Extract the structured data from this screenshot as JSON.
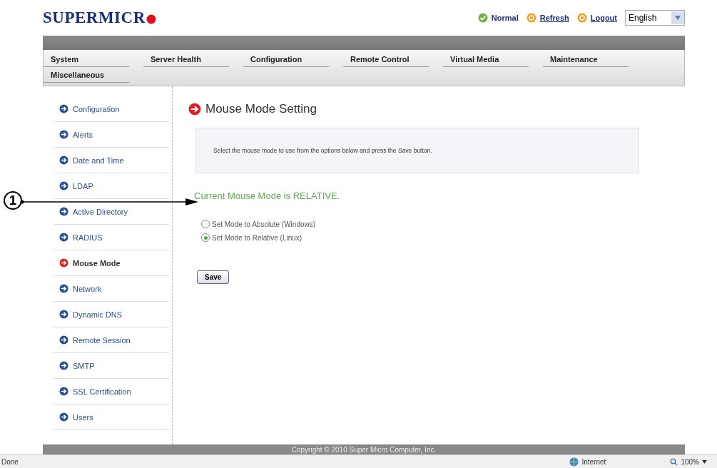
{
  "header": {
    "logo": "SUPERMICR",
    "status": "Normal",
    "links": [
      "Refresh",
      "Logout"
    ],
    "language": "English"
  },
  "nav_tabs": [
    "System",
    "Server Health",
    "Configuration",
    "Remote Control",
    "Virtual Media",
    "Maintenance",
    "Miscellaneous"
  ],
  "sidebar": {
    "items": [
      {
        "label": "Configuration",
        "selected": false
      },
      {
        "label": "Alerts",
        "selected": false
      },
      {
        "label": "Date and Time",
        "selected": false
      },
      {
        "label": "LDAP",
        "selected": false
      },
      {
        "label": "Active Directory",
        "selected": false
      },
      {
        "label": "RADIUS",
        "selected": false
      },
      {
        "label": "Mouse Mode",
        "selected": true
      },
      {
        "label": "Network",
        "selected": false
      },
      {
        "label": "Dynamic DNS",
        "selected": false
      },
      {
        "label": "Remote Session",
        "selected": false
      },
      {
        "label": "SMTP",
        "selected": false
      },
      {
        "label": "SSL Certification",
        "selected": false
      },
      {
        "label": "Users",
        "selected": false
      }
    ]
  },
  "content": {
    "title": "Mouse Mode Setting",
    "info": "Select the mouse mode to use from the options below and press the Save button.",
    "current_mode": "Current Mouse Mode is RELATIVE.",
    "options": [
      {
        "label": "Set Mode to Absolute (Windows)",
        "selected": false
      },
      {
        "label": "Set Mode to Relative (Linux)",
        "selected": true
      }
    ],
    "save_button": "Save"
  },
  "callout": "1",
  "footer": "Copyright © 2010 Super Micro Computer, Inc.",
  "browser_status": {
    "left": "Done",
    "zone": "Internet",
    "zoom": "100%"
  }
}
